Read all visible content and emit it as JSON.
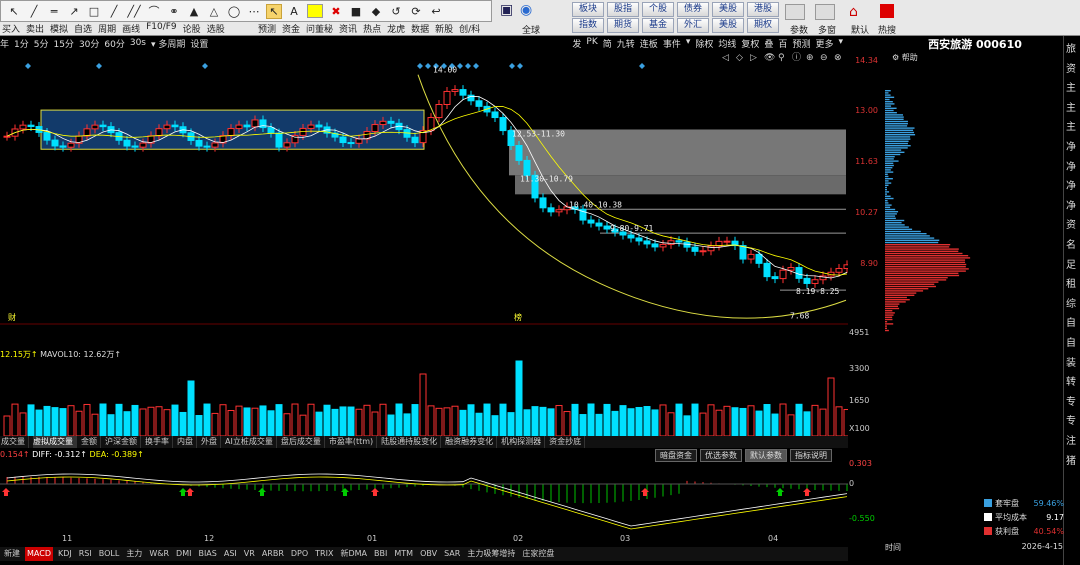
{
  "menu": [
    "买入",
    "卖出",
    "模拟",
    "自选",
    "周期",
    "画线",
    "F10/F9",
    "论股",
    "选股"
  ],
  "drawtools": [
    "↖",
    "╱",
    "═",
    "↗",
    "□",
    "╱",
    "╱╱",
    "⌒",
    "⚭",
    "▲",
    "△",
    "◯",
    "⋯",
    "↖",
    "A",
    "■",
    "✖",
    "■",
    "◆",
    "↺",
    "⟳",
    "↩"
  ],
  "midtools": {
    "col1": [
      "预测",
      "资金",
      "问董秘",
      "资讯",
      "热点",
      "龙虎",
      "数据",
      "新股",
      "创/科"
    ],
    "row1": [
      "板块",
      "股指",
      "个股",
      "债券",
      "美股",
      "港股"
    ],
    "row2": [
      "指数",
      "期货",
      "基金",
      "外汇",
      "美股",
      "期权"
    ],
    "far": [
      "全球",
      "参数",
      "多窗",
      "默认",
      "热搜"
    ]
  },
  "tabs_left": [
    "年",
    "1分",
    "5分",
    "15分",
    "30分",
    "60分",
    "30s",
    "▾ 多周期",
    "设置"
  ],
  "tabs_right": [
    "发",
    "PK",
    "简",
    "九转",
    "连板",
    "事件",
    "▾",
    "除权",
    "均线",
    "复权",
    "叠",
    "百",
    "预测",
    "更多",
    "▾"
  ],
  "stock": {
    "name": "西安旅游",
    "code": "000610"
  },
  "help": "帮助",
  "price_axis": [
    "14.34",
    "13.00",
    "11.63",
    "10.27",
    "8.90"
  ],
  "annotations": [
    "14.00",
    "12.53-11.30",
    "11.30-10.79",
    "10.40-10.38",
    "9.80-9.71",
    "8.19-8.25",
    "7.68"
  ],
  "flags": [
    "财",
    "榜"
  ],
  "vol_label": {
    "a": "12.15万↑",
    "b": "MAVOL10: 12.62万↑"
  },
  "vol_axis": [
    "4951",
    "3300",
    "1650",
    "X100"
  ],
  "ind_tabs": [
    "成交量",
    "虚拟成交量",
    "金额",
    "沪深金额",
    "换手率",
    "内盘",
    "外盘",
    "AI立桩成交量",
    "盘后成交量",
    "市盈率(ttm)",
    "陆股通持股变化",
    "融资融券变化",
    "机构探测器",
    "资金抄底"
  ],
  "macd": {
    "macd": "0.154↑",
    "diff": "DIFF: -0.312↑",
    "dea": "DEA: -0.389↑",
    "axis": [
      "0.303",
      "0",
      "-0.550"
    ]
  },
  "macd_btns": [
    "暗盘资金",
    "优选参数",
    "默认参数",
    "指标说明"
  ],
  "months": [
    "11",
    "12",
    "01",
    "02",
    "03",
    "04"
  ],
  "bottom_tabs": [
    "新建",
    "MACD",
    "KDJ",
    "RSI",
    "BOLL",
    "主力",
    "W&R",
    "DMI",
    "BIAS",
    "ASI",
    "VR",
    "ARBR",
    "DPO",
    "TRIX",
    "新DMA",
    "BBI",
    "MTM",
    "OBV",
    "SAR",
    "主力吸筹增持",
    "庄家控盘"
  ],
  "legend": [
    {
      "label": "套牢盘",
      "value": "59.46%",
      "color": "#3aa0e0"
    },
    {
      "label": "平均成本",
      "value": "9.17",
      "color": "#ffffff"
    },
    {
      "label": "获利盘",
      "value": "40.54%",
      "color": "#e03030"
    }
  ],
  "time": {
    "label": "时间",
    "value": "2026-4-15"
  },
  "far_right": [
    "旅",
    "资",
    "主",
    "主",
    "主",
    "净",
    "净",
    "净",
    "净",
    "资",
    "名",
    "足",
    "租",
    "综",
    "自",
    "自",
    "装",
    "转",
    "专",
    "专",
    "注",
    "猪"
  ],
  "colors": {
    "up": "#ff3232",
    "down": "#00e0ff",
    "yellow": "#ffff00"
  }
}
